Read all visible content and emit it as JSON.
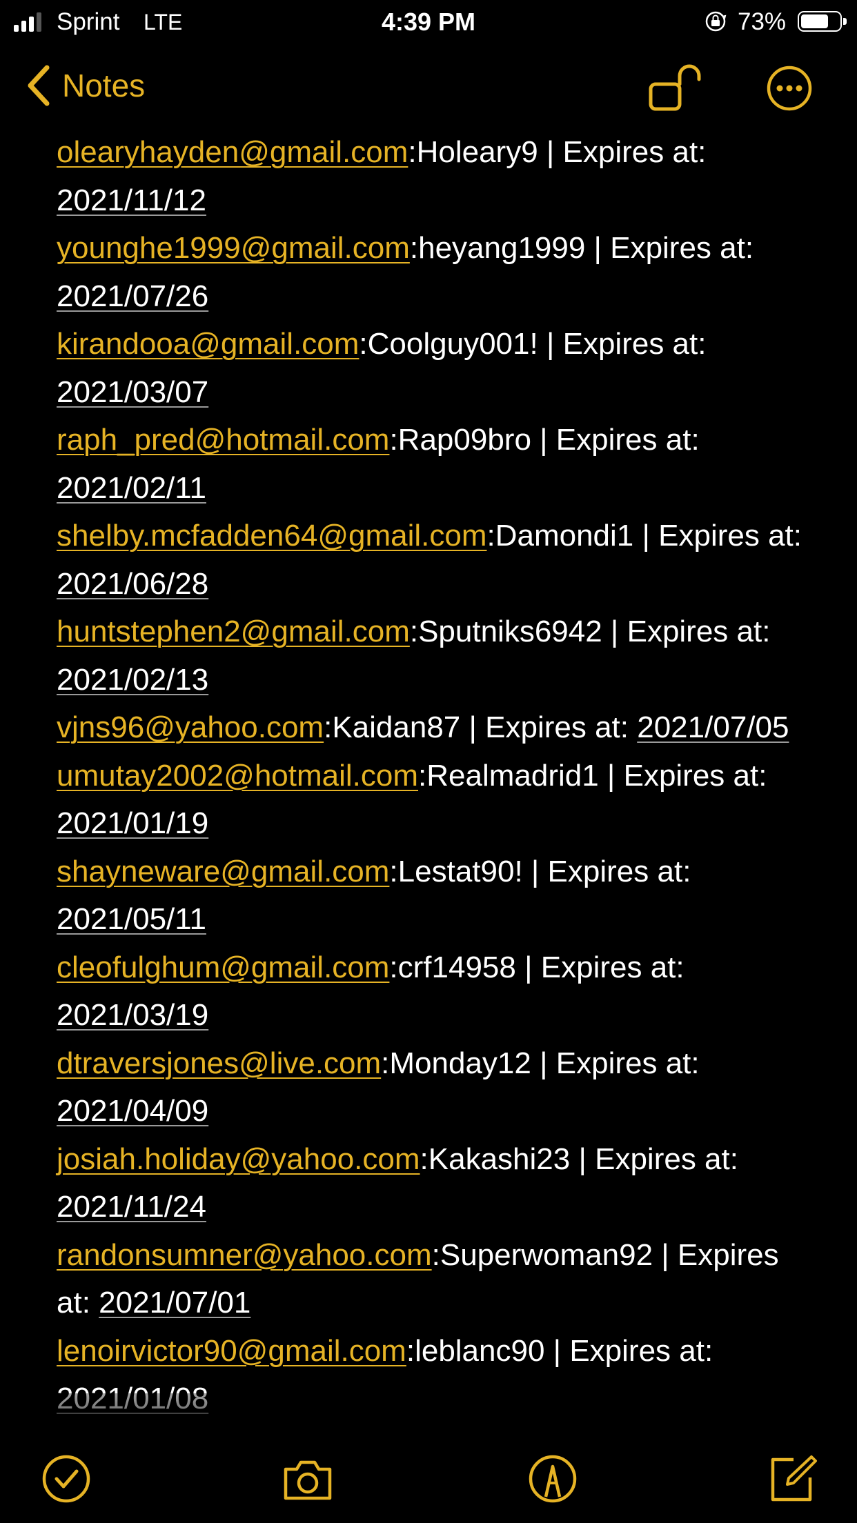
{
  "status_bar": {
    "carrier": "Sprint",
    "network": "LTE",
    "time": "4:39 PM",
    "battery_percent": "73%",
    "battery_level": 0.73,
    "signal_bars": 3
  },
  "nav": {
    "back_label": "Notes"
  },
  "note": {
    "entries": [
      {
        "email": "olearyhayden@gmail.com",
        "rest": ":Holeary9 | Expires at: ",
        "date": "2021/11/12"
      },
      {
        "email": "younghe1999@gmail.com",
        "rest": ":heyang1999 | Expires at: ",
        "date": "2021/07/26"
      },
      {
        "email": "kirandooa@gmail.com",
        "rest": ":Coolguy001! | Expires at: ",
        "date": "2021/03/07"
      },
      {
        "email": "raph_pred@hotmail.com",
        "rest": ":Rap09bro | Expires at: ",
        "date": "2021/02/11"
      },
      {
        "email": "shelby.mcfadden64@gmail.com",
        "rest": ":Damondi1 | Expires at: ",
        "date": "2021/06/28"
      },
      {
        "email": "huntstephen2@gmail.com",
        "rest": ":Sputniks6942 | Expires at: ",
        "date": "2021/02/13"
      },
      {
        "email": "vjns96@yahoo.com",
        "rest": ":Kaidan87 | Expires at: ",
        "date": "2021/07/05"
      },
      {
        "email": "umutay2002@hotmail.com",
        "rest": ":Realmadrid1 | Expires at: ",
        "date": "2021/01/19"
      },
      {
        "email": "shayneware@gmail.com",
        "rest": ":Lestat90! | Expires at: ",
        "date": "2021/05/11"
      },
      {
        "email": "cleofulghum@gmail.com",
        "rest": ":crf14958 | Expires at: ",
        "date": "2021/03/19"
      },
      {
        "email": "dtraversjones@live.com",
        "rest": ":Monday12 | Expires at: ",
        "date": "2021/04/09"
      },
      {
        "email": "josiah.holiday@yahoo.com",
        "rest": ":Kakashi23 | Expires at: ",
        "date": "2021/11/24"
      },
      {
        "email": "randonsumner@yahoo.com",
        "rest": ":Superwoman92 | Expires at: ",
        "date": "2021/07/01"
      },
      {
        "email": "lenoirvictor90@gmail.com",
        "rest": ":leblanc90 | Expires at: ",
        "date": "2021/01/08"
      }
    ]
  },
  "toolbar": {
    "items": [
      "checklist-icon",
      "camera-icon",
      "markup-pen-icon",
      "compose-icon"
    ]
  },
  "colors": {
    "accent": "#e6b325",
    "background": "#000000",
    "text": "#ffffff"
  }
}
